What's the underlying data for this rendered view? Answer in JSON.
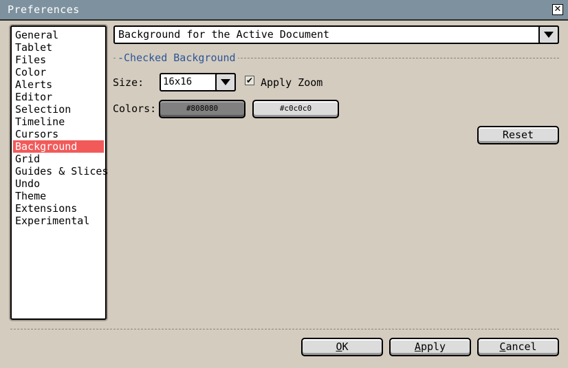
{
  "window": {
    "title": "Preferences",
    "close_symbol": "✕"
  },
  "sections": [
    "General",
    "Tablet",
    "Files",
    "Color",
    "Alerts",
    "Editor",
    "Selection",
    "Timeline",
    "Cursors",
    "Background",
    "Grid",
    "Guides & Slices",
    "Undo",
    "Theme",
    "Extensions",
    "Experimental"
  ],
  "selected_section": "Background",
  "document_select": {
    "value": "Background for the Active Document"
  },
  "checked_background": {
    "heading": "-Checked Background",
    "size_label": "Size:",
    "size_value": "16x16",
    "apply_zoom_label": "Apply Zoom",
    "apply_zoom_checked": true,
    "colors_label": "Colors:",
    "color1": "#808080",
    "color2": "#c0c0c0",
    "reset_label": "Reset"
  },
  "footer": {
    "ok_label": "OK",
    "ok_mnemonic": "O",
    "ok_rest": "K",
    "apply_label": "Apply",
    "apply_mnemonic": "A",
    "apply_rest": "pply",
    "cancel_label": "Cancel",
    "cancel_mnemonic": "C",
    "cancel_rest": "ancel"
  },
  "colors": {
    "titlebar": "#7d929e",
    "background": "#d4ccbf",
    "selection": "#f25a5a",
    "heading": "#2c5596"
  }
}
